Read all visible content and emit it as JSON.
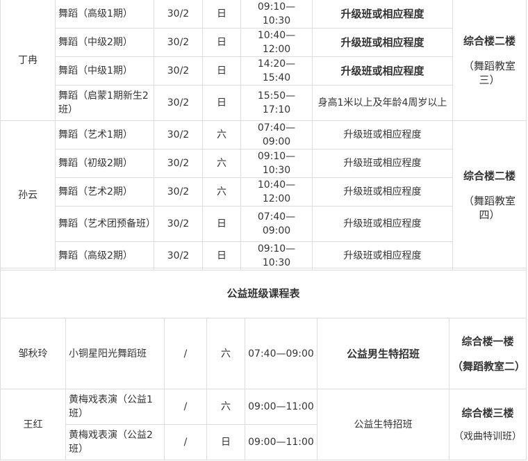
{
  "schedule": {
    "ding": {
      "teacher": "丁冉",
      "room_main": "综合楼二楼",
      "room_sub": "（舞蹈教室三）",
      "rows": [
        {
          "course": "舞蹈（高级1期）",
          "hours": "30/2",
          "day": "日",
          "time": "09:10—10:30",
          "req": "升级班或相应程度"
        },
        {
          "course": "舞蹈（中级2期）",
          "hours": "30/2",
          "day": "日",
          "time": "10:40—12:00",
          "req": "升级班或相应程度"
        },
        {
          "course": "舞蹈（中级1期）",
          "hours": "30/2",
          "day": "日",
          "time": "14:20—15:40",
          "req": "升级班或相应程度"
        },
        {
          "course": "舞蹈（启蒙1期新生2班）",
          "hours": "30/2",
          "day": "日",
          "time": "15:50—17:10",
          "req": "身高1米以上及年龄4周岁以上"
        }
      ]
    },
    "sun": {
      "teacher": "孙云",
      "room_main": "综合楼二楼",
      "room_sub": "（舞蹈教室四）",
      "rows": [
        {
          "course": "舞蹈（艺术1期）",
          "hours": "30/2",
          "day": "六",
          "time": "07:40—09:00",
          "req": "升级班或相应程度"
        },
        {
          "course": "舞蹈（初级2期）",
          "hours": "30/2",
          "day": "六",
          "time": "09:10—10:30",
          "req": "升级班或相应程度"
        },
        {
          "course": "舞蹈（艺术2期）",
          "hours": "30/2",
          "day": "六",
          "time": "10:40—12:00",
          "req": "升级班或相应程度"
        },
        {
          "course": "舞蹈（艺术团预备班）",
          "hours": "30/2",
          "day": "日",
          "time": "07:40—09:00",
          "req": "升级班或相应程度"
        },
        {
          "course": "舞蹈（高级2期）",
          "hours": "30/2",
          "day": "日",
          "time": "09:10—10:30",
          "req": "升级班或相应程度"
        }
      ]
    }
  },
  "public": {
    "title": "公益班级课程表",
    "zou": {
      "teacher": "邹秋玲",
      "course": "小铜星阳光舞蹈班",
      "hours": "/",
      "day": "六",
      "time": "07:40—09:00",
      "req": "公益男生特招班",
      "room_main": "综合楼一楼",
      "room_sub": "（舞蹈教室二）"
    },
    "wang": {
      "teacher": "王红",
      "req": "公益生特招班",
      "room_main": "综合楼三楼",
      "room_sub": "（戏曲特训班）",
      "rows": [
        {
          "course": "黄梅戏表演（公益1班）",
          "hours": "/",
          "day": "六",
          "time": "09:00—11:00"
        },
        {
          "course": "黄梅戏表演（公益2班）",
          "hours": "/",
          "day": "日",
          "time": "09:00—11:00"
        }
      ]
    }
  }
}
